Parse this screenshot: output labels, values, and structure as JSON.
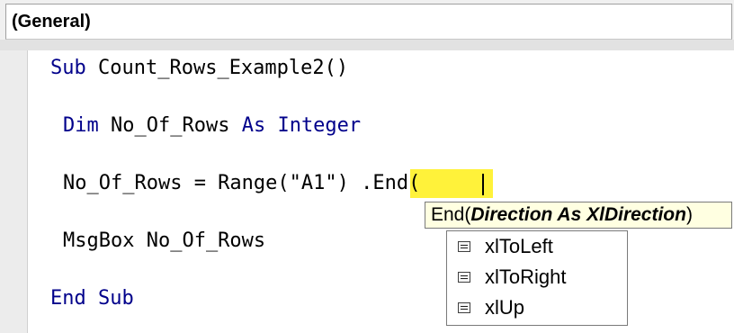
{
  "object_dropdown": {
    "value": "(General)"
  },
  "code": {
    "sub_keyword": "Sub",
    "sub_name": " Count_Rows_Example2()",
    "dim_keyword": "Dim",
    "dim_var": " No_Of_Rows ",
    "as_keyword": "As",
    "type_keyword": " Integer",
    "assign_prefix": "No_Of_Rows = Range(\"A1\")",
    "assign_end": ".End(",
    "msgbox_line": "MsgBox No_Of_Rows",
    "end_sub": "End Sub"
  },
  "param_tip": {
    "prefix": "End(",
    "param": "Direction As XlDirection",
    "suffix": ")"
  },
  "constants": [
    {
      "label": "xlToLeft",
      "icon": "enum-constant-icon"
    },
    {
      "label": "xlToRight",
      "icon": "enum-constant-icon"
    },
    {
      "label": "xlUp",
      "icon": "enum-constant-icon"
    }
  ],
  "colors": {
    "keyword": "#00008b",
    "highlight": "#fff23a",
    "tooltip_bg": "#ffffe1"
  }
}
